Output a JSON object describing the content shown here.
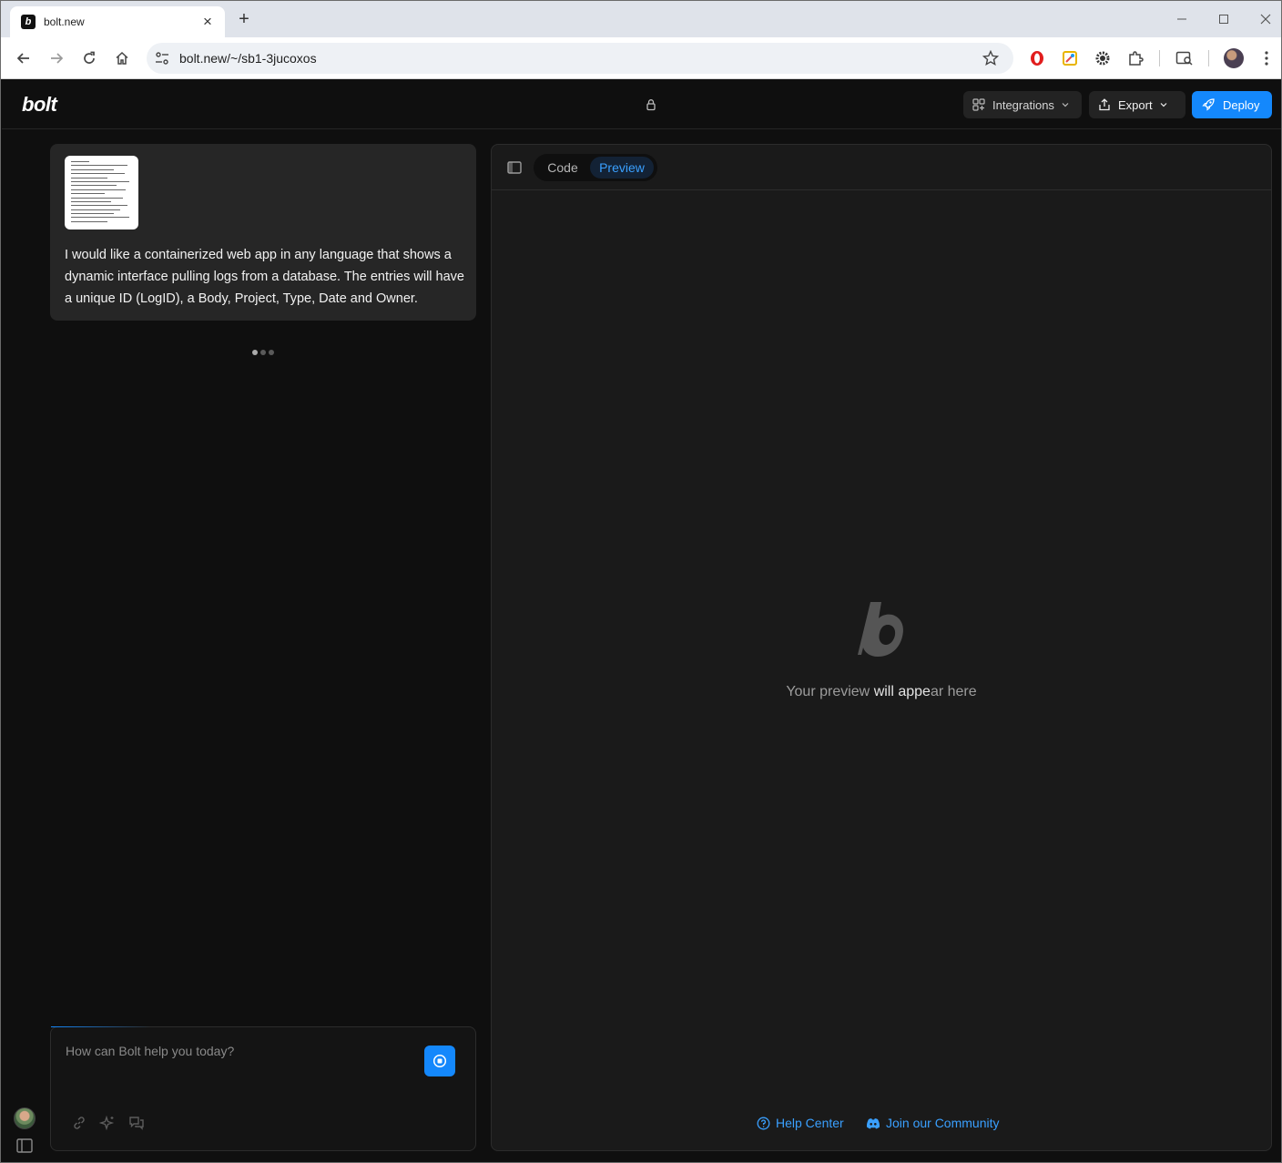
{
  "browser": {
    "tab_title": "bolt.new",
    "url": "bolt.new/~/sb1-3jucoxos"
  },
  "header": {
    "logo": "bolt",
    "integrations_label": "Integrations",
    "export_label": "Export",
    "deploy_label": "Deploy"
  },
  "chat": {
    "message": "I would like a containerized web app in any language that shows a dynamic interface pulling logs from a database.  The entries will have a unique ID (LogID), a Body, Project, Type, Date and Owner.",
    "prompt_placeholder": "How can Bolt help you today?"
  },
  "workbench": {
    "tab_code": "Code",
    "tab_preview": "Preview",
    "preview_text_1": "Your preview ",
    "preview_text_2": "will appe",
    "preview_text_3": "ar here",
    "help_center": "Help Center",
    "community": "Join our Community"
  },
  "colors": {
    "accent": "#1488fc",
    "link": "#3aa0ff",
    "background": "#0f0f0f",
    "panel": "#1a1a1a"
  }
}
